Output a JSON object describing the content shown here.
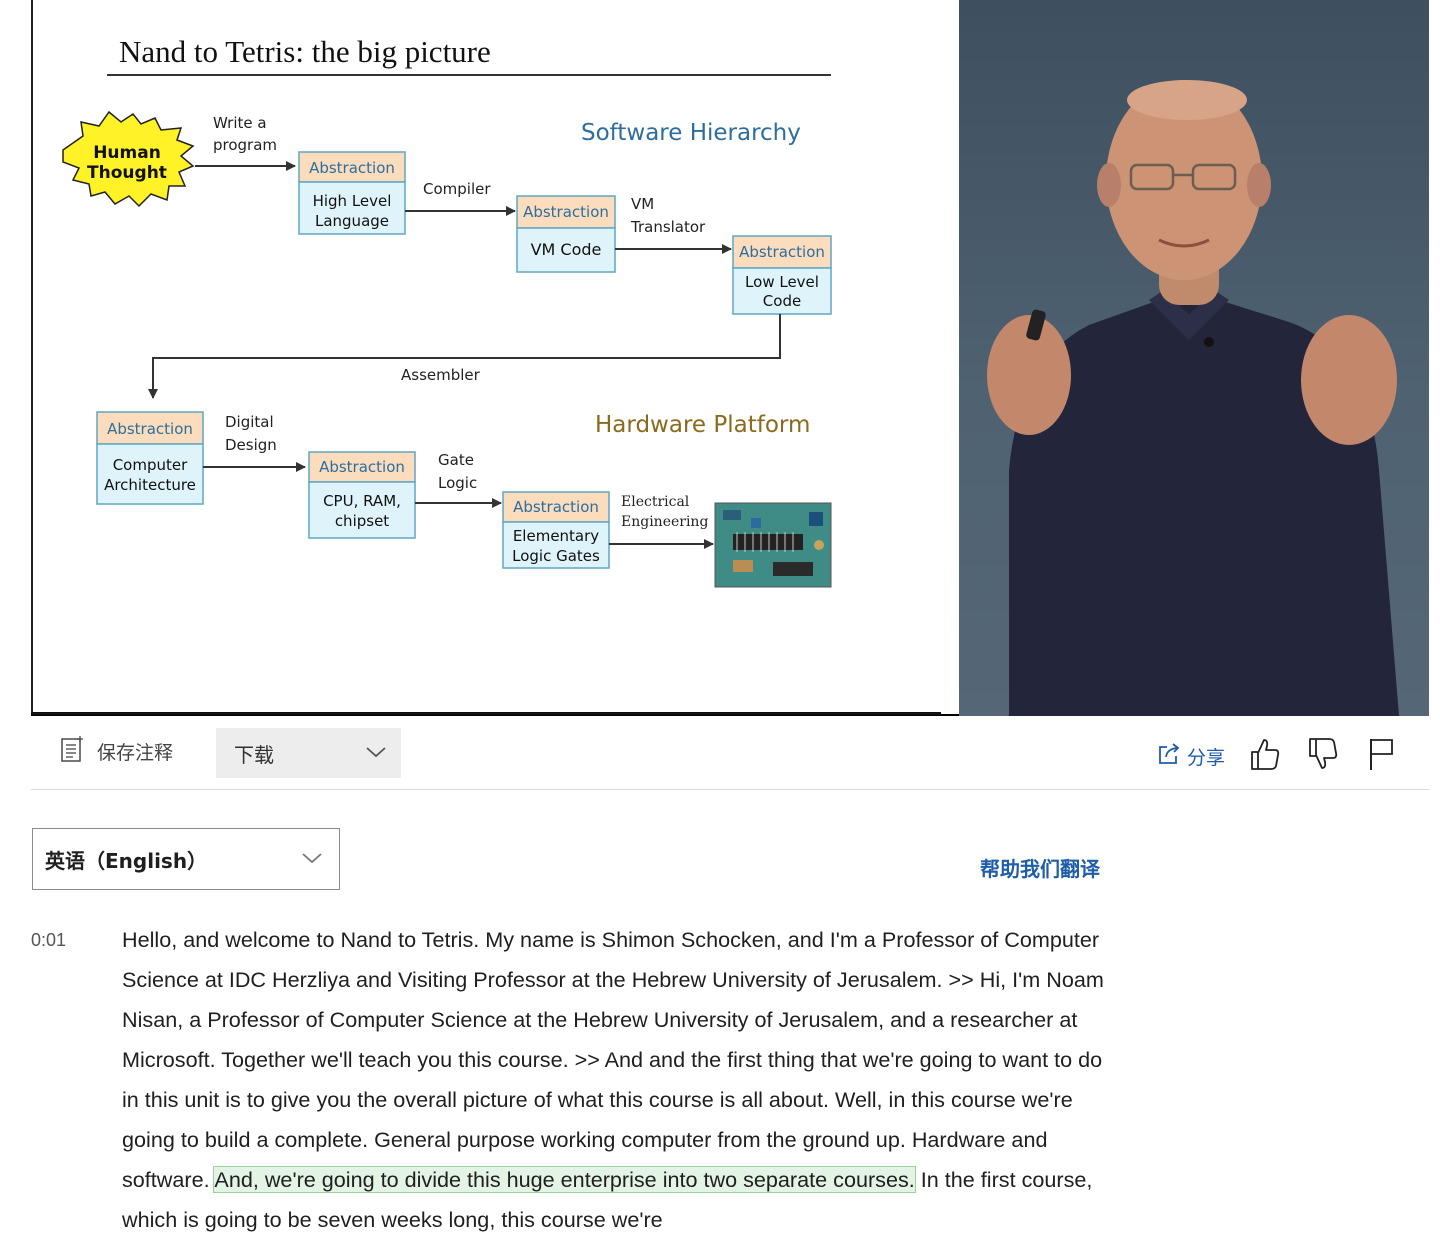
{
  "slide": {
    "title": "Nand to Tetris: the big picture",
    "software_heading": "Software Hierarchy",
    "hardware_heading": "Hardware Platform",
    "human_thought": [
      "Human",
      "Thought"
    ],
    "abstraction_label": "Abstraction",
    "boxes": {
      "high_level": [
        "High Level",
        "Language"
      ],
      "vm_code": [
        "VM Code"
      ],
      "low_level": [
        "Low Level",
        "Code"
      ],
      "computer_arch": [
        "Computer",
        "Architecture"
      ],
      "cpu_ram": [
        "CPU, RAM,",
        "chipset"
      ],
      "logic_gates": [
        "Elementary",
        "Logic Gates"
      ]
    },
    "arrows": {
      "write_program": [
        "Write a",
        "program"
      ],
      "compiler": [
        "Compiler"
      ],
      "vm_translator": [
        "VM",
        "Translator"
      ],
      "assembler": [
        "Assembler"
      ],
      "digital_design": [
        "Digital",
        "Design"
      ],
      "gate_logic": [
        "Gate",
        "Logic"
      ],
      "electrical": [
        "Electrical",
        "Engineering"
      ]
    }
  },
  "toolbar": {
    "save_notes_label": "保存注释",
    "download_label": "下载",
    "share_label": "分享"
  },
  "language": {
    "selected": "英语（English）",
    "help_translate": "帮助我们翻译"
  },
  "transcript": {
    "timestamp": "0:01",
    "before": "Hello, and welcome to Nand to Tetris. My name is Shimon Schocken, and I'm a Professor of Computer Science at IDC Herzliya and Visiting Professor at the Hebrew University of Jerusalem. >> Hi, I'm Noam Nisan, a Professor of Computer Science at the Hebrew University of Jerusalem, and a researcher at Microsoft. Together we'll teach you this course. >> And and the first thing that we're going to want to do in this unit is to give you the overall picture of what this course is all about. Well, in this course we're going to build a complete. General purpose working computer from the ground up. Hardware and software. ",
    "highlighted": "And, we're going to divide this huge enterprise into two separate courses.",
    "after": " In the first course, which is going to be seven weeks long, this course we're"
  },
  "colors": {
    "link_blue": "#1f5da8",
    "abstraction_fill": "#fbdcbc",
    "box_fill": "#dff4fa",
    "starburst_fill": "#fff227",
    "software_heading": "#2e6e9e",
    "hardware_heading": "#8a6a1c",
    "highlight_fill": "#e3f3e4"
  }
}
